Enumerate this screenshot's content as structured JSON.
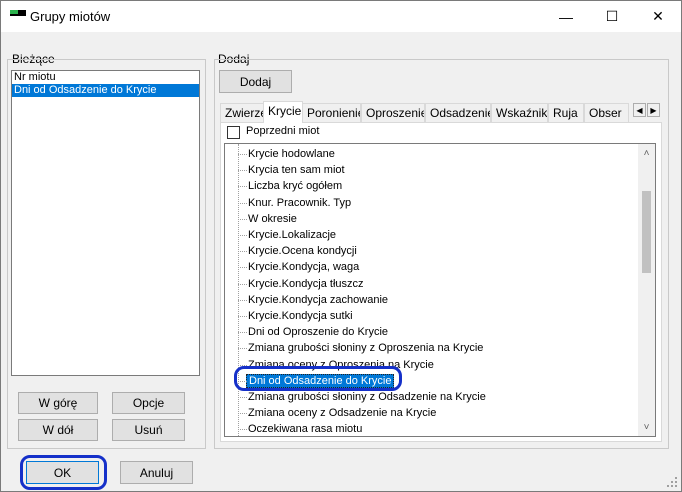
{
  "window": {
    "title": "Grupy miotów",
    "controls": {
      "minimize": "—",
      "maximize": "☐",
      "close": "✕"
    }
  },
  "current_group": {
    "label": "Bieżące",
    "items": [
      {
        "text": "Nr miotu",
        "selected": false
      },
      {
        "text": "Dni od Odsadzenie do Krycie",
        "selected": true
      }
    ],
    "buttons": {
      "up": "W górę",
      "options": "Opcje",
      "down": "W dół",
      "remove": "Usuń"
    }
  },
  "add_group": {
    "label": "Dodaj",
    "add_button": "Dodaj",
    "tabs": [
      {
        "label": "Zwierzę",
        "active": false
      },
      {
        "label": "Krycie",
        "active": true
      },
      {
        "label": "Poronienie",
        "active": false
      },
      {
        "label": "Oproszenie",
        "active": false
      },
      {
        "label": "Odsadzenie",
        "active": false
      },
      {
        "label": "Wskaźniki",
        "active": false
      },
      {
        "label": "Ruja",
        "active": false
      },
      {
        "label": "Obser",
        "active": false
      }
    ],
    "tab_scroll": {
      "left": "◀",
      "right": "▶"
    },
    "checkbox_label": "Poprzedni miot",
    "checkbox_checked": false,
    "tree_items": [
      "Krycie hodowlane",
      "Krycia ten sam miot",
      "Liczba kryć ogółem",
      "Knur. Pracownik. Typ",
      "W okresie",
      "Krycie.Lokalizacje",
      "Krycie.Ocena kondycji",
      "Krycie.Kondycja, waga",
      "Krycie.Kondycja tłuszcz",
      "Krycie.Kondycja zachowanie",
      "Krycie.Kondycja sutki",
      "Dni od Oproszenie do Krycie",
      "Zmiana grubości słoniny z Oproszenia na Krycie",
      "Zmiana oceny z Oproszenia na Krycie",
      "Dni od Odsadzenie do Krycie",
      "Zmiana grubości słoniny z Odsadzenie na Krycie",
      "Zmiana oceny z Odsadzenie na Krycie",
      "Oczekiwana rasa miotu"
    ],
    "selected_tree_item": "Dni od Odsadzenie do Krycie",
    "scroll_arrows": {
      "up": "˄",
      "down": "˅"
    }
  },
  "footer": {
    "ok": "OK",
    "cancel": "Anuluj"
  },
  "colors": {
    "selection": "#0078d7",
    "highlight_ring": "#1530c9",
    "app_icon_green": "#2bb24c"
  }
}
